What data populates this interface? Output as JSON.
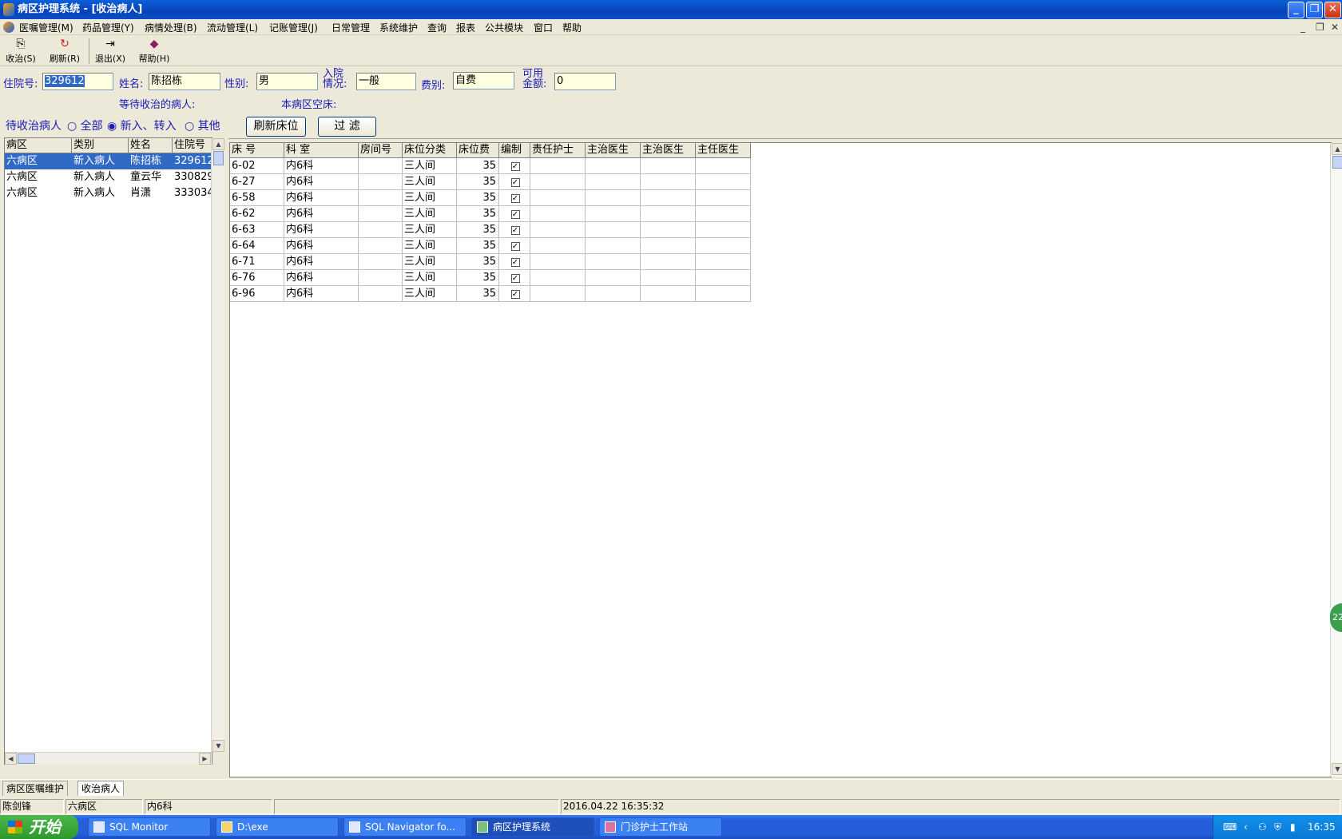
{
  "window": {
    "title": "病区护理系统 - [收治病人]"
  },
  "menu": [
    "医嘱管理(M)",
    "药品管理(Y)",
    "病情处理(B)",
    "流动管理(L)",
    "记账管理(J)",
    "日常管理",
    "系统维护",
    "查询",
    "报表",
    "公共模块",
    "窗口",
    "帮助"
  ],
  "toolbar": {
    "admit": "收治(S)",
    "refresh": "刷新(R)",
    "exit": "退出(X)",
    "help": "帮助(H)"
  },
  "form": {
    "inpatient_no_label": "住院号:",
    "inpatient_no": "329612",
    "name_label": "姓名:",
    "name": "陈招栋",
    "gender_label": "性别:",
    "gender": "男",
    "admission_label_1": "入院",
    "admission_label_2": "情况:",
    "admission": "一般",
    "fee_label": "费别:",
    "fee": "自费",
    "avail_label_1": "可用",
    "avail_label_2": "金额:",
    "avail": "0",
    "waiting_label": "等待收治的病人:",
    "empty_beds_label": "本病区空床:"
  },
  "left": {
    "title": "待收治病人",
    "radio_all": "全部",
    "radio_new": "新入、转入",
    "radio_other": "其他",
    "headers": [
      "病区",
      "类别",
      "姓名",
      "住院号"
    ],
    "rows": [
      [
        "六病区",
        "新入病人",
        "陈招栋",
        "329612"
      ],
      [
        "六病区",
        "新入病人",
        "童云华",
        "330829"
      ],
      [
        "六病区",
        "新入病人",
        "肖潇",
        "333034"
      ]
    ]
  },
  "right": {
    "refresh_beds": "刷新床位",
    "filter": "过  滤",
    "headers": [
      "床  号",
      "科  室",
      "房间号",
      "床位分类",
      "床位费",
      "编制",
      "责任护士",
      "主治医生",
      "主治医生",
      "主任医生"
    ],
    "rows": [
      [
        "6-02",
        "内6科",
        "",
        "三人间",
        "35",
        "✓",
        "",
        "",
        "",
        ""
      ],
      [
        "6-27",
        "内6科",
        "",
        "三人间",
        "35",
        "✓",
        "",
        "",
        "",
        ""
      ],
      [
        "6-58",
        "内6科",
        "",
        "三人间",
        "35",
        "✓",
        "",
        "",
        "",
        ""
      ],
      [
        "6-62",
        "内6科",
        "",
        "三人间",
        "35",
        "✓",
        "",
        "",
        "",
        ""
      ],
      [
        "6-63",
        "内6科",
        "",
        "三人间",
        "35",
        "✓",
        "",
        "",
        "",
        ""
      ],
      [
        "6-64",
        "内6科",
        "",
        "三人间",
        "35",
        "✓",
        "",
        "",
        "",
        ""
      ],
      [
        "6-71",
        "内6科",
        "",
        "三人间",
        "35",
        "✓",
        "",
        "",
        "",
        ""
      ],
      [
        "6-76",
        "内6科",
        "",
        "三人间",
        "35",
        "✓",
        "",
        "",
        "",
        ""
      ],
      [
        "6-96",
        "内6科",
        "",
        "三人间",
        "35",
        "✓",
        "",
        "",
        "",
        ""
      ]
    ]
  },
  "tabs": [
    "病区医嘱维护",
    "收治病人"
  ],
  "status": {
    "user": "陈剑锋",
    "ward": "六病区",
    "dept": "内6科",
    "datetime": "2016.04.22 16:35:32"
  },
  "taskbar": {
    "start": "开始",
    "tasks": [
      "SQL Monitor",
      "D:\\exe",
      "SQL Navigator fo...",
      "病区护理系统",
      "门诊护士工作站"
    ],
    "clock": "16:35"
  },
  "badge": "22"
}
